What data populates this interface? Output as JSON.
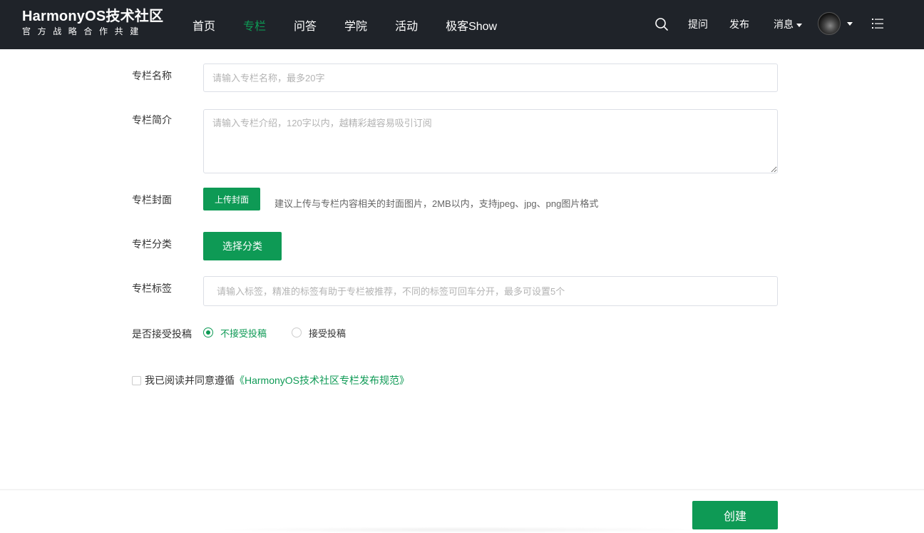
{
  "header": {
    "brand_title": "HarmonyOS技术社区",
    "brand_subtitle": "官方战略合作共建",
    "nav": [
      {
        "label": "首页",
        "active": false
      },
      {
        "label": "专栏",
        "active": true
      },
      {
        "label": "问答",
        "active": false
      },
      {
        "label": "学院",
        "active": false
      },
      {
        "label": "活动",
        "active": false
      },
      {
        "label": "极客Show",
        "active": false
      }
    ],
    "ask_label": "提问",
    "publish_label": "发布",
    "messages_label": "消息",
    "accent_color": "#0e9a55",
    "background_color": "#1f2329"
  },
  "form": {
    "name": {
      "label": "专栏名称",
      "placeholder": "请输入专栏名称，最多20字",
      "value": ""
    },
    "intro": {
      "label": "专栏简介",
      "placeholder": "请输入专栏介绍，120字以内，越精彩越容易吸引订阅",
      "value": ""
    },
    "cover": {
      "label": "专栏封面",
      "button": "上传封面",
      "hint": "建议上传与专栏内容相关的封面图片，2MB以内，支持jpeg、jpg、png图片格式"
    },
    "category": {
      "label": "专栏分类",
      "button": "选择分类"
    },
    "tags": {
      "label": "专栏标签",
      "placeholder": "请输入标签，精准的标签有助于专栏被推荐，不同的标签可回车分开，最多可设置5个",
      "value": ""
    },
    "submission": {
      "label": "是否接受投稿",
      "options": [
        {
          "label": "不接受投稿",
          "checked": true
        },
        {
          "label": "接受投稿",
          "checked": false
        }
      ]
    },
    "agreement": {
      "text": "我已阅读并同意遵循",
      "link": "《HarmonyOS技术社区专栏发布规范》",
      "checked": false
    }
  },
  "footer": {
    "create_button": "创建"
  }
}
